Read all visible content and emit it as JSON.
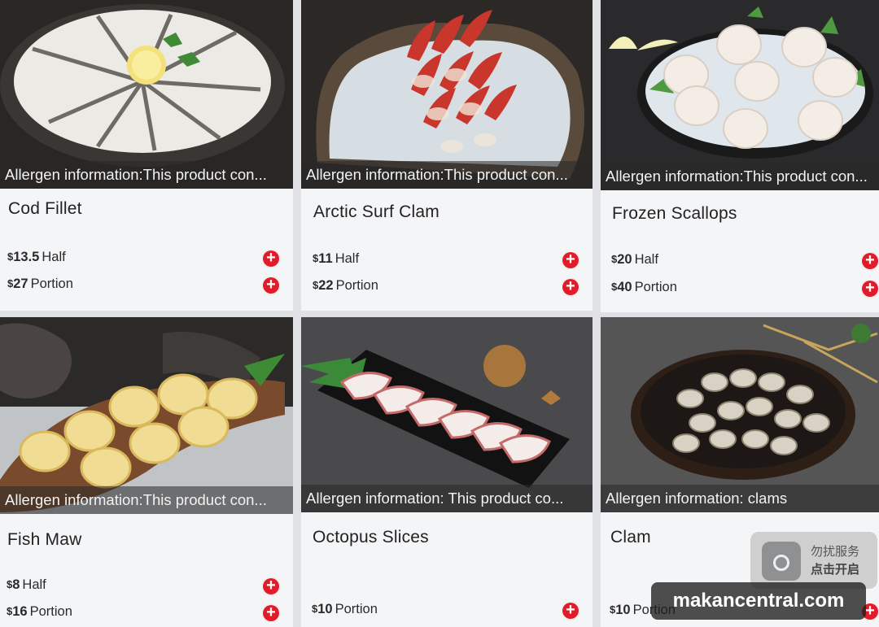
{
  "products": [
    {
      "name": "Cod Fillet",
      "allergen": "Allergen information:This product con...",
      "prices": [
        {
          "amount": "13.5",
          "unit": "Half"
        },
        {
          "amount": "27",
          "unit": "Portion"
        }
      ]
    },
    {
      "name": "Arctic Surf Clam",
      "allergen": "Allergen information:This product con...",
      "prices": [
        {
          "amount": "11",
          "unit": "Half"
        },
        {
          "amount": "22",
          "unit": "Portion"
        }
      ]
    },
    {
      "name": "Frozen Scallops",
      "allergen": "Allergen information:This product con...",
      "prices": [
        {
          "amount": "20",
          "unit": "Half"
        },
        {
          "amount": "40",
          "unit": "Portion"
        }
      ]
    },
    {
      "name": "Fish Maw",
      "allergen": "Allergen information:This product con...",
      "prices": [
        {
          "amount": "8",
          "unit": "Half"
        },
        {
          "amount": "16",
          "unit": "Portion"
        }
      ]
    },
    {
      "name": "Octopus Slices",
      "allergen": "Allergen information: This product co...",
      "prices": [
        {
          "amount": "10",
          "unit": "Portion"
        }
      ]
    },
    {
      "name": "Clam",
      "allergen": "Allergen information: clams",
      "prices": [
        {
          "amount": "10",
          "unit": "Portion"
        }
      ]
    }
  ],
  "currency_symbol": "$",
  "add_symbol": "+",
  "dnd_widget": {
    "line1": "勿扰服务",
    "line2": "点击开启"
  },
  "watermark": "makancentral.com",
  "colors": {
    "accent": "#e11c2a",
    "card_bg": "#f4f5f7",
    "page_bg": "#dfe1e4"
  }
}
